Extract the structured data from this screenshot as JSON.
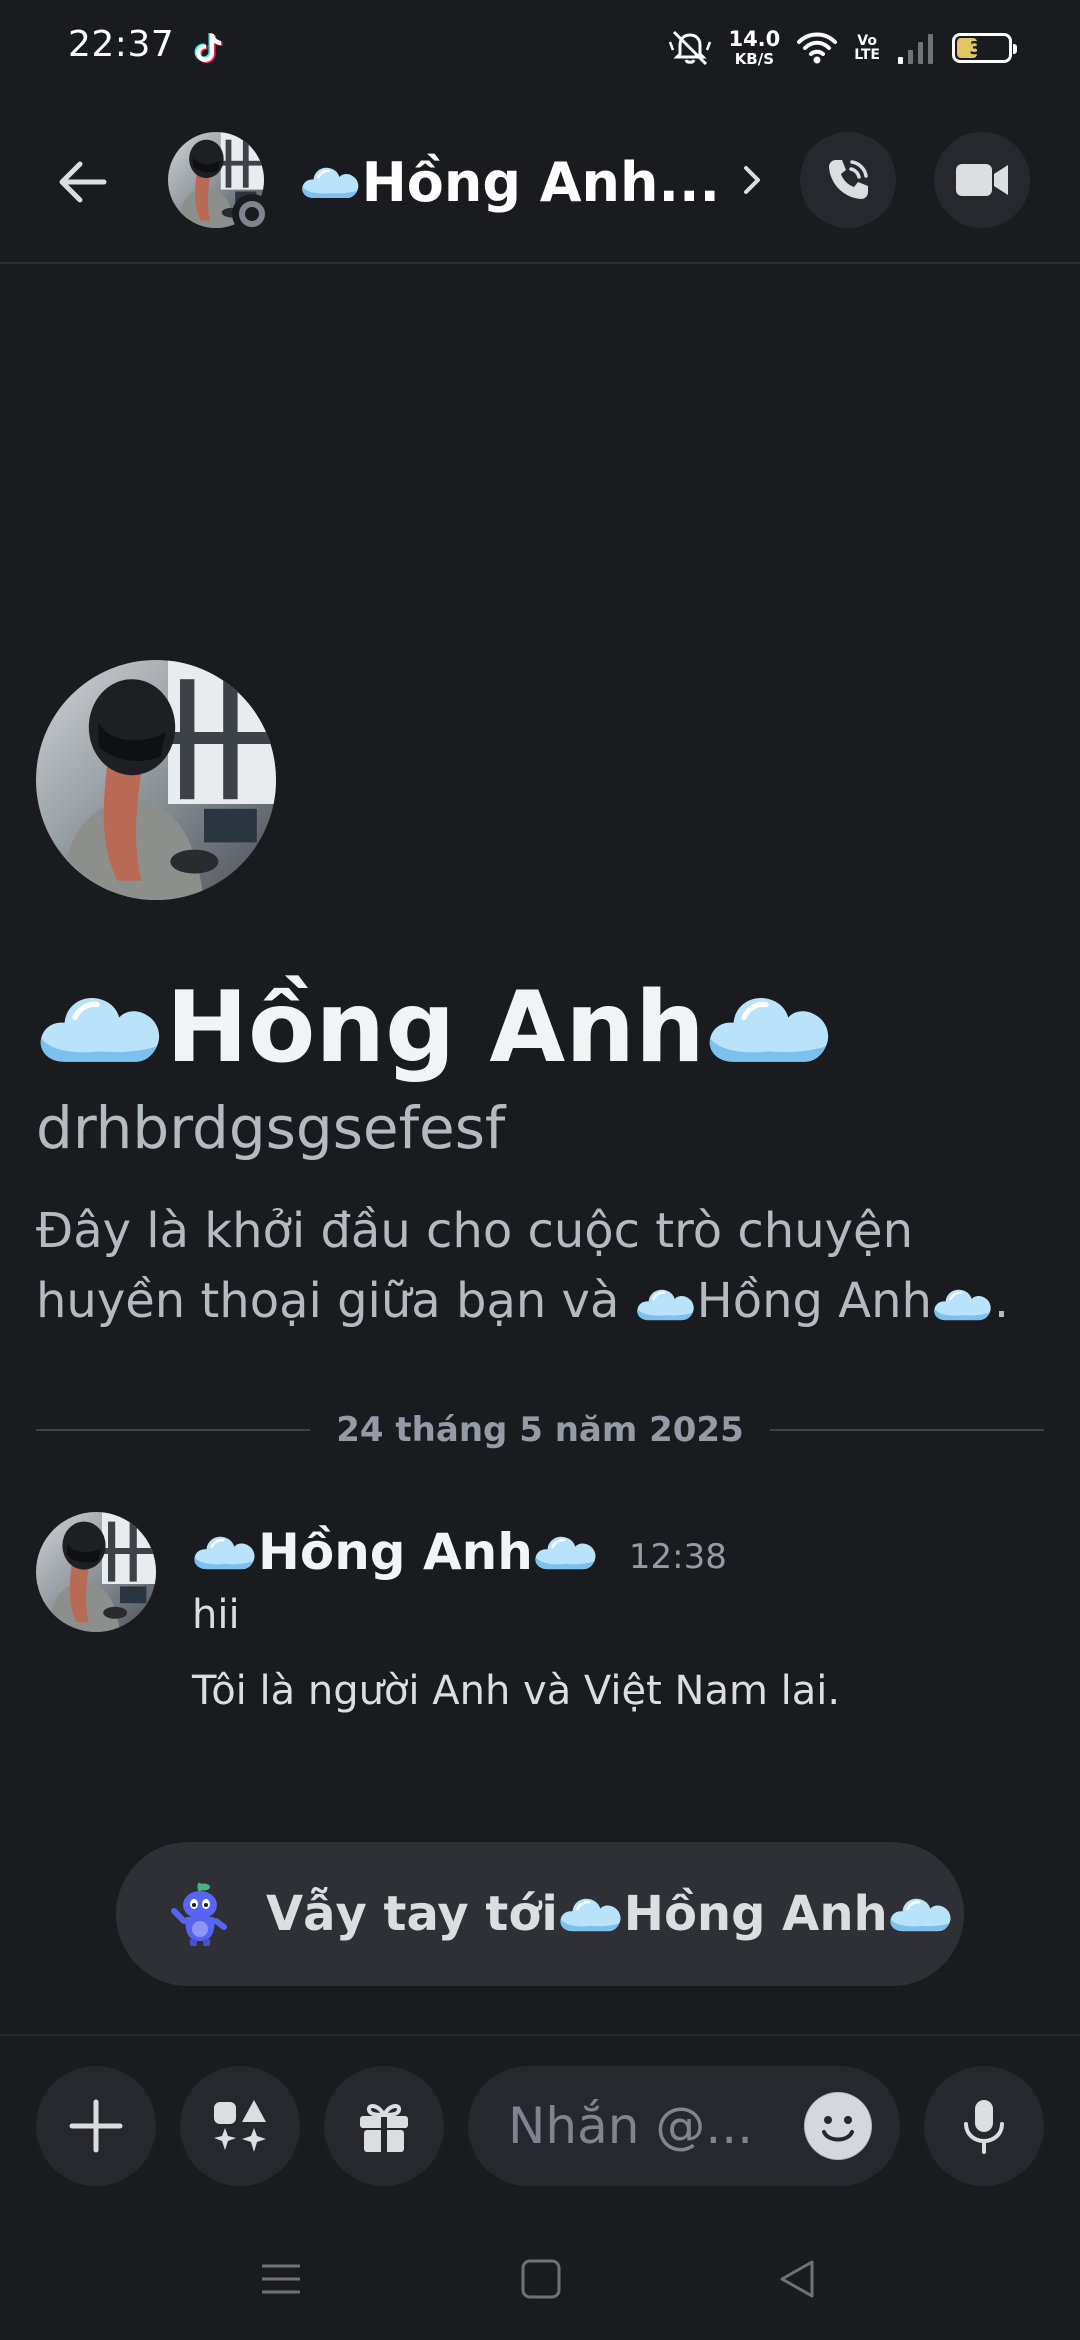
{
  "status_bar": {
    "time": "22:37",
    "net_speed_value": "14.0",
    "net_speed_unit": "KB/S",
    "volte_top": "Vo",
    "volte_bottom": "LTE",
    "battery_level": "37",
    "battery_fraction": 0.37,
    "battery_color": "#e2c565"
  },
  "header": {
    "contact_name": "Hồng Anh...",
    "avatar_status": "offline",
    "status_color": "#80848e"
  },
  "intro": {
    "name": "Hồng Anh",
    "username": "drhbrdgsgsefesf",
    "description_prefix": "Đây là khởi đầu cho cuộc trò chuyện huyền thoại giữa bạn và ",
    "description_name": "Hồng Anh",
    "description_suffix": "."
  },
  "date_divider": "24 tháng 5 năm 2025",
  "message": {
    "author": "Hồng Anh",
    "time": "12:38",
    "lines": [
      "hii",
      "Tôi là người Anh và Việt Nam lai."
    ]
  },
  "wave_button": {
    "prefix": "Vẫy tay tới ",
    "name": "Hồng Anh"
  },
  "composer": {
    "placeholder": "Nhắn @..."
  },
  "icons": {
    "back": "arrow-left-icon",
    "call": "phone-call-icon",
    "video": "video-camera-icon",
    "plus": "plus-icon",
    "apps": "apps-icon",
    "gift": "gift-icon",
    "emoji": "emoji-icon",
    "mic": "microphone-icon",
    "cloud": "cloud-emoji-icon",
    "wumpus": "wumpus-wave-icon"
  },
  "colors": {
    "background": "#1a1b1f",
    "surface": "#26282d",
    "text_primary": "#f2f3f5",
    "text_muted": "#b5bac1",
    "cloud": "#9fd4f5"
  }
}
